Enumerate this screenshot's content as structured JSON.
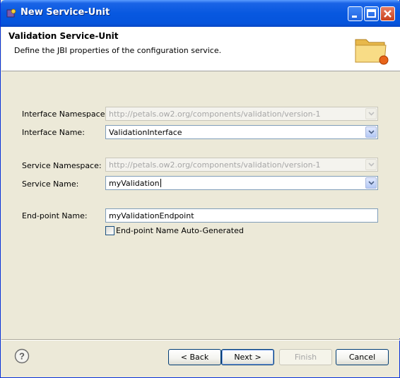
{
  "window": {
    "title": "New Service-Unit"
  },
  "header": {
    "title": "Validation Service-Unit",
    "description": "Define the JBI properties of the configuration service."
  },
  "form": {
    "interface_namespace": {
      "label": "Interface Namespace:",
      "value": "http://petals.ow2.org/components/validation/version-1",
      "enabled": false
    },
    "interface_name": {
      "label": "Interface Name:",
      "value": "ValidationInterface",
      "enabled": true
    },
    "service_namespace": {
      "label": "Service Namespace:",
      "value": "http://petals.ow2.org/components/validation/version-1",
      "enabled": false
    },
    "service_name": {
      "label": "Service Name:",
      "value": "myValidation",
      "enabled": true
    },
    "endpoint_name": {
      "label": "End-point Name:",
      "value": "myValidationEndpoint"
    },
    "endpoint_autogen": {
      "label": "End-point Name Auto-Generated",
      "checked": false
    }
  },
  "buttons": {
    "back": "< Back",
    "next": "Next >",
    "finish": "Finish",
    "cancel": "Cancel"
  },
  "icons": {
    "title": "app-icon",
    "header": "folder-icon",
    "help": "help-icon"
  }
}
